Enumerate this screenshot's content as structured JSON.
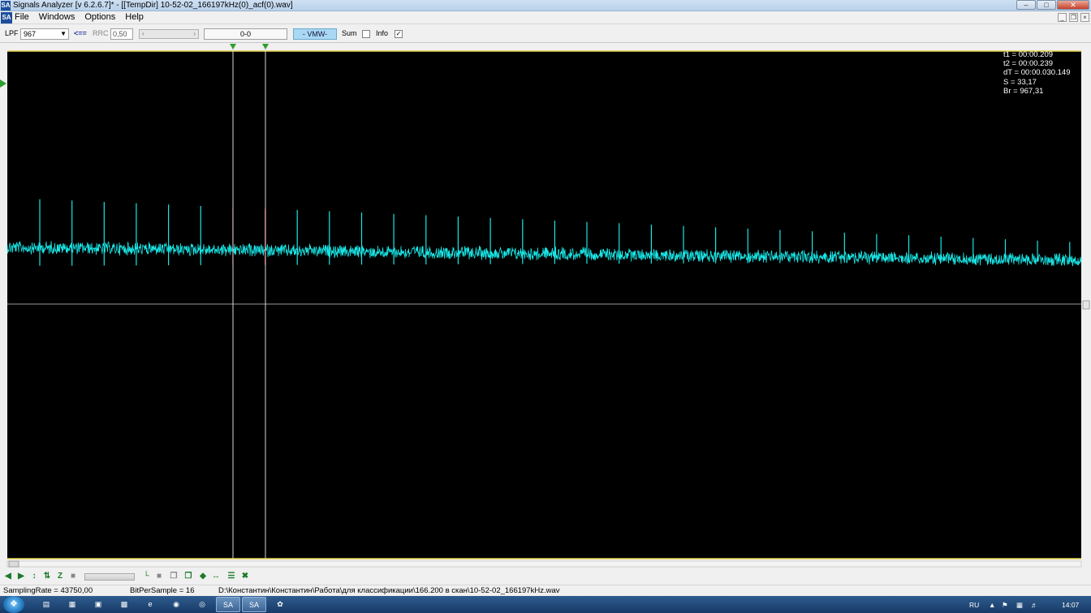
{
  "window": {
    "title": "Signals Analyzer [v 6.2.6.7]* - [[TempDir] 10-52-02_166197kHz(0)_acf(0).wav]",
    "app_icon": "SA",
    "buttons": [
      "minimize-icon",
      "maximize-icon",
      "close-icon"
    ]
  },
  "menu": {
    "items": [
      "File",
      "Windows",
      "Options",
      "Help"
    ]
  },
  "toolbar": {
    "lpf_label": "LPF",
    "lpf_value": "967",
    "arrow_label": "<==",
    "rrc_label": "RRC",
    "rrc_value": "0,50",
    "range_value": "0-0",
    "mode_value": "- VMW-",
    "sum_label": "Sum",
    "sum_checked": false,
    "info_label": "Info",
    "info_checked": true
  },
  "measurements": {
    "t1": "t1 = 00:00.209",
    "t2": "t2 = 00:00.239",
    "dT": "dT = 00:00.030.149",
    "S": "S = 33,17",
    "Br": "Br = 967,31"
  },
  "plot": {
    "background": "#000000",
    "trace_color": "#19e6e6",
    "border_color": "#e6d34a",
    "cursor_color": "#d8d8d8",
    "marker_color": "#2e9e2e",
    "highlight_color": "#c0202a",
    "cursor_t1": 0.209,
    "cursor_t2": 0.239,
    "burst_period_s": 0.030149
  },
  "bottom_tools": {
    "icons": [
      "nav-left-right-icon",
      "nav-fit-icon",
      "zoom-vertical-icon",
      "zoom-fit-vertical-icon",
      "zoom-plus-icon",
      "stop-icon",
      "crop-icon",
      "stop-square-icon",
      "copy-icon",
      "paste-icon",
      "diamond-icon",
      "fit-width-icon",
      "bars-icon",
      "cross-icon"
    ]
  },
  "status": {
    "sampling_rate": "SamplingRate = 43750,00",
    "bits_per_sample": "BitPerSample = 16",
    "file_path": "D:\\Константин\\Константин\\Работа\\для классификации\\166.200 в скан\\10-52-02_166197kHz.wav"
  },
  "taskbar": {
    "apps": [
      "explorer",
      "totalcmd",
      "excel",
      "sheet",
      "ie",
      "speaker",
      "chrome",
      "sa1",
      "sa2",
      "paint"
    ],
    "language": "RU",
    "clock": "14:07"
  }
}
